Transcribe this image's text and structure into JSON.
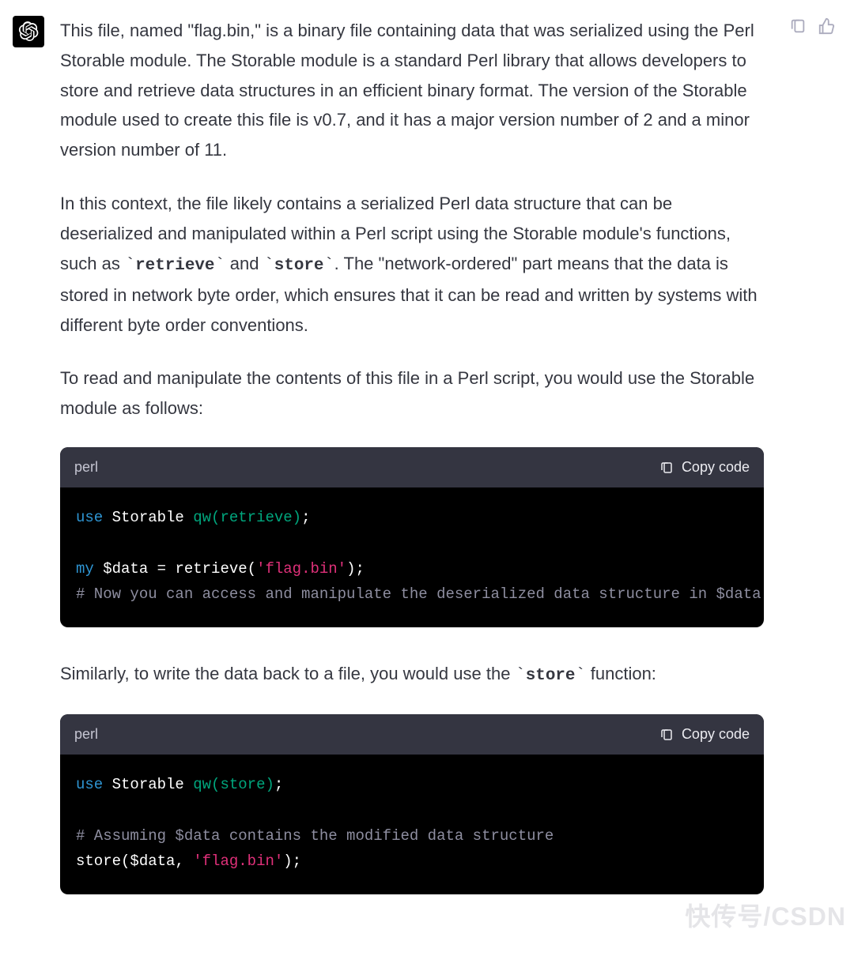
{
  "toolbar": {
    "copy_icon_label": "Copy message",
    "like_icon_label": "Like"
  },
  "message": {
    "p1": "This file, named \"flag.bin,\" is a binary file containing data that was serialized using the Perl Storable module. The Storable module is a standard Perl library that allows developers to store and retrieve data structures in an efficient binary format. The version of the Storable module used to create this file is v0.7, and it has a major version number of 2 and a minor version number of 11.",
    "p2_pre": "In this context, the file likely contains a serialized Perl data structure that can be deserialized and manipulated within a Perl script using the Storable module's functions, such as ",
    "p2_code1": "retrieve",
    "p2_mid": " and ",
    "p2_code2": "store",
    "p2_post": ". The \"network-ordered\" part means that the data is stored in network byte order, which ensures that it can be read and written by systems with different byte order conventions.",
    "p3": "To read and manipulate the contents of this file in a Perl script, you would use the Storable module as follows:",
    "p4_pre": "Similarly, to write the data back to a file, you would use the ",
    "p4_code": "store",
    "p4_post": " function:"
  },
  "codeblocks": [
    {
      "lang": "perl",
      "copy_label": "Copy code",
      "tokens": [
        {
          "t": "kw",
          "v": "use"
        },
        {
          "t": "plain",
          "v": " Storable "
        },
        {
          "t": "fn",
          "v": "qw(retrieve)"
        },
        {
          "t": "plain",
          "v": ";\n\n"
        },
        {
          "t": "kw",
          "v": "my"
        },
        {
          "t": "plain",
          "v": " "
        },
        {
          "t": "var",
          "v": "$data"
        },
        {
          "t": "plain",
          "v": " = retrieve("
        },
        {
          "t": "str",
          "v": "'flag.bin'"
        },
        {
          "t": "plain",
          "v": ");\n"
        },
        {
          "t": "cmt",
          "v": "# Now you can access and manipulate the deserialized data structure in $data"
        }
      ]
    },
    {
      "lang": "perl",
      "copy_label": "Copy code",
      "tokens": [
        {
          "t": "kw",
          "v": "use"
        },
        {
          "t": "plain",
          "v": " Storable "
        },
        {
          "t": "fn",
          "v": "qw(store)"
        },
        {
          "t": "plain",
          "v": ";\n\n"
        },
        {
          "t": "cmt",
          "v": "# Assuming $data contains the modified data structure\n"
        },
        {
          "t": "plain",
          "v": "store("
        },
        {
          "t": "var",
          "v": "$data"
        },
        {
          "t": "plain",
          "v": ", "
        },
        {
          "t": "str",
          "v": "'flag.bin'"
        },
        {
          "t": "plain",
          "v": ");"
        }
      ]
    }
  ],
  "watermark": "快传号/CSDN"
}
